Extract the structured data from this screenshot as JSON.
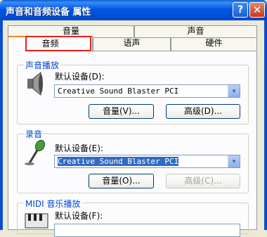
{
  "window": {
    "title": "声音和音频设备 属性",
    "help_glyph": "?",
    "close_glyph": "✕"
  },
  "tabs": {
    "row1": [
      "音量",
      "声音"
    ],
    "row2": [
      "音频",
      "语声",
      "硬件"
    ],
    "active": "音频"
  },
  "sound_playback": {
    "group_title": "声音播放",
    "default_device_label": "默认设备(D):",
    "device": "Creative Sound Blaster PCI",
    "volume_button": "音量(V)...",
    "advanced_button": "高级(D)..."
  },
  "recording": {
    "group_title": "录音",
    "default_device_label": "默认设备(E):",
    "device": "Creative Sound Blaster PCI",
    "volume_button": "音量(O)...",
    "advanced_button": "高级(C)..."
  },
  "midi": {
    "group_title": "MIDI 音乐播放",
    "default_device_label": "默认设备(F):"
  },
  "colors": {
    "titlebar": "#0058e6",
    "group_title": "#0046d5",
    "highlight": "#e2211c",
    "selection": "#316ac5"
  }
}
